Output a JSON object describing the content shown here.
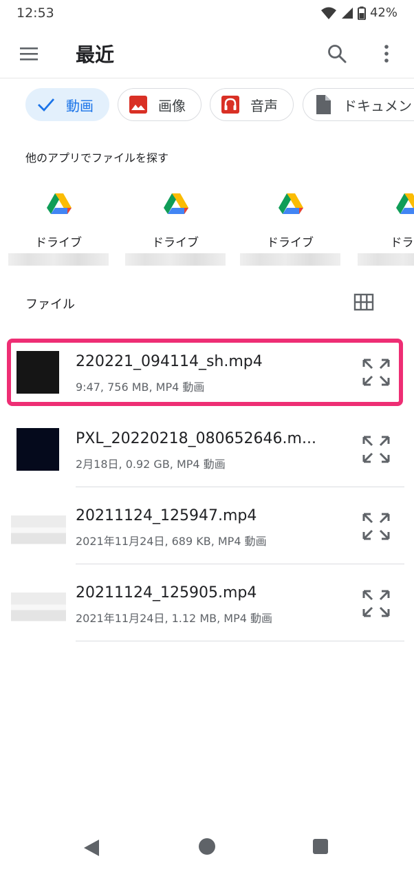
{
  "status_bar": {
    "time": "12:53",
    "battery": "42%"
  },
  "app_bar": {
    "title": "最近"
  },
  "chips": [
    {
      "label": "動画",
      "icon": "check-icon",
      "selected": true
    },
    {
      "label": "画像",
      "icon": "image-icon",
      "selected": false
    },
    {
      "label": "音声",
      "icon": "headphones-icon",
      "selected": false
    },
    {
      "label": "ドキュメン",
      "icon": "document-icon",
      "selected": false
    }
  ],
  "other_apps": {
    "heading": "他のアプリでファイルを探す",
    "apps": [
      {
        "name": "ドライブ",
        "icon": "google-drive-icon"
      },
      {
        "name": "ドライブ",
        "icon": "google-drive-icon"
      },
      {
        "name": "ドライブ",
        "icon": "google-drive-icon"
      },
      {
        "name": "ドライ",
        "icon": "google-drive-icon"
      }
    ]
  },
  "files": {
    "heading": "ファイル",
    "items": [
      {
        "name": "220221_094114_sh.mp4",
        "meta": "9:47, 756 MB, MP4 動画",
        "highlighted": true
      },
      {
        "name": "PXL_20220218_080652646.m...",
        "meta": "2月18日, 0.92 GB, MP4 動画",
        "highlighted": false
      },
      {
        "name": "20211124_125947.mp4",
        "meta": "2021年11月24日, 689 KB, MP4 動画",
        "highlighted": false
      },
      {
        "name": "20211124_125905.mp4",
        "meta": "2021年11月24日, 1.12 MB, MP4 動画",
        "highlighted": false
      }
    ]
  },
  "colors": {
    "accent": "#1a73e8",
    "selected_chip_bg": "#e3f0fc",
    "highlight_border": "#ee2e74"
  }
}
